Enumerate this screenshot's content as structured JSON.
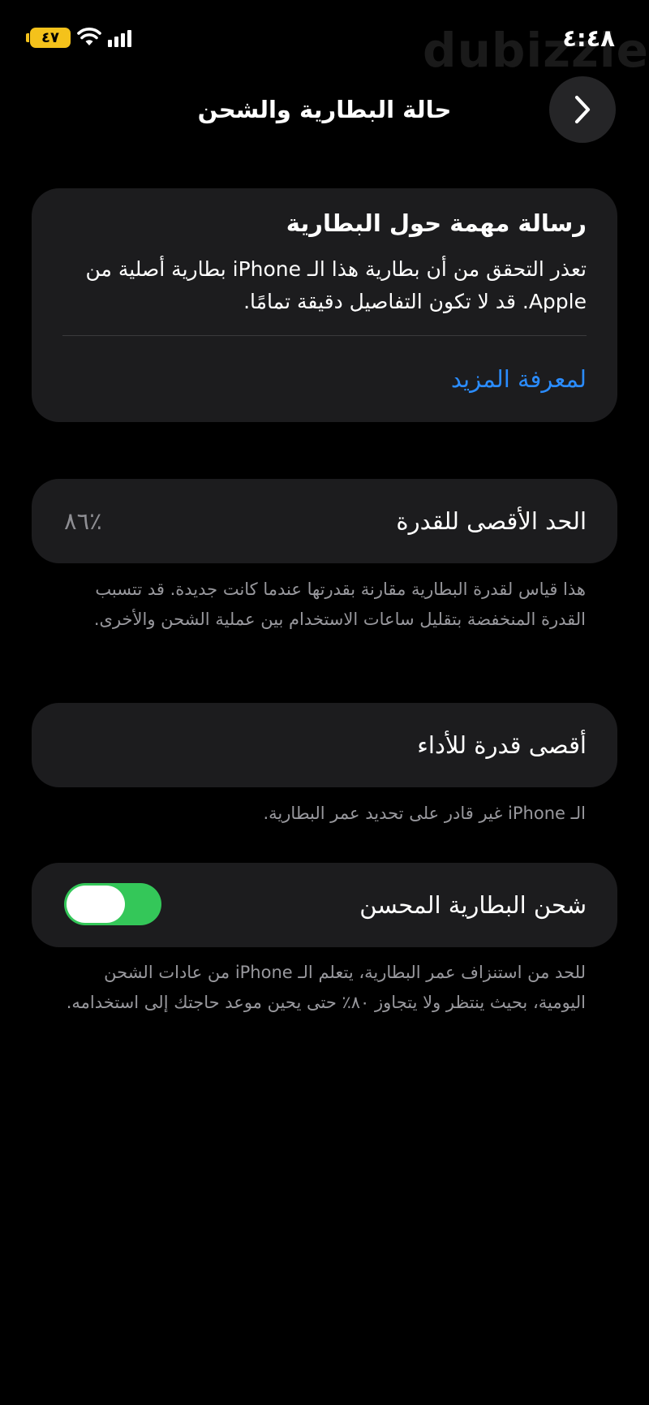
{
  "status_bar": {
    "time": "٤:٤٨",
    "battery_level": "٤٧",
    "battery_color": "#f4c21b",
    "watermark": "dubizzle"
  },
  "header": {
    "title": "حالة البطارية والشحن",
    "back_icon": "chevron-right-icon"
  },
  "important_message": {
    "title": "رسالة مهمة حول البطارية",
    "body": "تعذر التحقق من أن بطارية هذا الـ iPhone بطارية أصلية من Apple. قد لا تكون التفاصيل دقيقة تمامًا.",
    "link": "لمعرفة المزيد",
    "link_color": "#2a8cff"
  },
  "max_capacity": {
    "label": "الحد الأقصى للقدرة",
    "value": "٨٦٪",
    "description": "هذا قياس لقدرة البطارية مقارنة بقدرتها عندما كانت جديدة. قد تتسبب القدرة المنخفضة بتقليل ساعات الاستخدام بين عملية الشحن والأخرى."
  },
  "peak_performance": {
    "label": "أقصى قدرة للأداء",
    "description": "الـ iPhone غير قادر على تحديد عمر البطارية."
  },
  "optimized_charging": {
    "label": "شحن البطارية المحسن",
    "enabled": true,
    "toggle_color": "#34c759",
    "description": "للحد من استنزاف عمر البطارية، يتعلم الـ iPhone من عادات الشحن اليومية، بحيث ينتظر ولا يتجاوز ٨٠٪ حتى يحين موعد حاجتك إلى استخدامه."
  }
}
